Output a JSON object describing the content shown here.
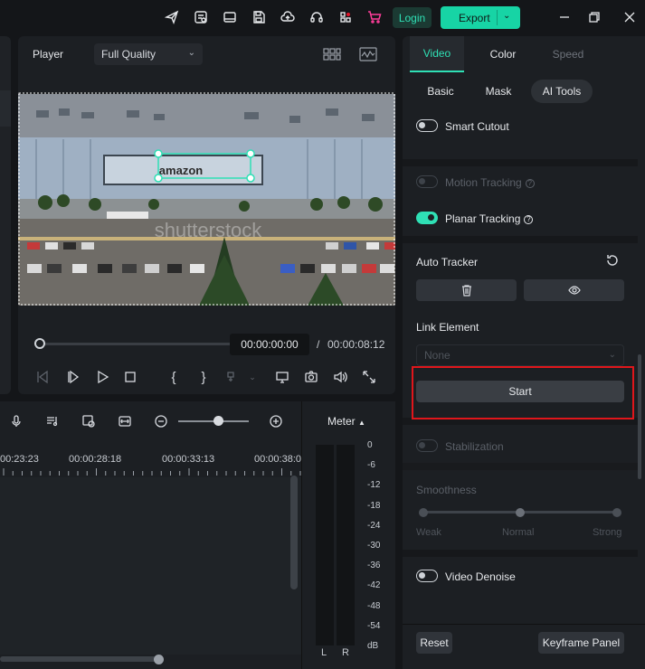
{
  "topbar": {
    "icons": [
      "send-icon",
      "task-list-icon",
      "layout-icon",
      "save-icon",
      "cloud-upload-icon",
      "headset-icon",
      "apps-grid-icon",
      "cart-icon"
    ],
    "login_label": "Login",
    "export_label": "Export"
  },
  "player": {
    "label": "Player",
    "quality": "Full Quality",
    "current_time": "00:00:00:00",
    "separator": "/",
    "total_time": "00:00:08:12",
    "watermark_text": "shutterstock",
    "sign_text": "amazon",
    "progress": 0
  },
  "timeline": {
    "ruler_labels": [
      "00:23:23",
      "00:00:28:18",
      "00:00:33:13",
      "00:00:38:0"
    ],
    "zoom_level": 0.55
  },
  "meter": {
    "title": "Meter",
    "scale": [
      "0",
      "-6",
      "-12",
      "-18",
      "-24",
      "-30",
      "-36",
      "-42",
      "-48",
      "-54",
      "dB"
    ],
    "left_label": "L",
    "right_label": "R"
  },
  "panel": {
    "tabs": [
      "Video",
      "Color",
      "Speed"
    ],
    "subtabs": [
      "Basic",
      "Mask",
      "AI Tools"
    ],
    "smart_cutout": "Smart Cutout",
    "motion_tracking": "Motion Tracking",
    "planar_tracking": "Planar Tracking",
    "auto_tracker": "Auto Tracker",
    "link_element": "Link Element",
    "link_placeholder": "None",
    "start_label": "Start",
    "stabilization": "Stabilization",
    "smoothness": "Smoothness",
    "smooth_weak": "Weak",
    "smooth_normal": "Normal",
    "smooth_strong": "Strong",
    "video_denoise": "Video Denoise",
    "reset_label": "Reset",
    "keyframe_label": "Keyframe Panel",
    "accent_color": "#2fe0b5",
    "highlight_color": "#e0161b"
  }
}
